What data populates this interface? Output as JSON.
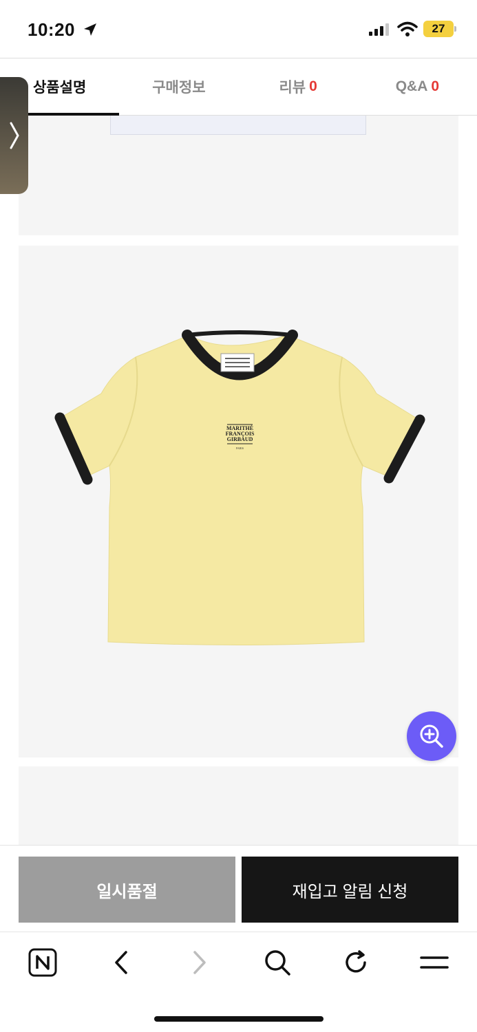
{
  "status": {
    "time": "10:20",
    "battery": "27"
  },
  "tabs": [
    {
      "label": "상품설명",
      "count": ""
    },
    {
      "label": "구매정보",
      "count": ""
    },
    {
      "label": "리뷰",
      "count": "0"
    },
    {
      "label": "Q&A",
      "count": "0"
    }
  ],
  "product_image": {
    "brand_lines": [
      "MARITHÉ",
      "FRANÇOIS",
      "GIRBAUD"
    ],
    "brand_sub": "PARIS"
  },
  "actions": {
    "soldout": "일시품절",
    "restock": "재입고 알림 신청"
  },
  "colors": {
    "accent": "#6c5cf7",
    "shirt": "#f5e9a3",
    "trim": "#1c1c1c",
    "badge": "#e53935"
  },
  "icons": [
    "location-arrow-icon",
    "signal-icon",
    "wifi-icon",
    "battery-icon",
    "chevron-right-icon",
    "zoom-in-icon",
    "naver-icon",
    "back-icon",
    "forward-icon",
    "search-icon",
    "refresh-icon",
    "menu-icon"
  ]
}
